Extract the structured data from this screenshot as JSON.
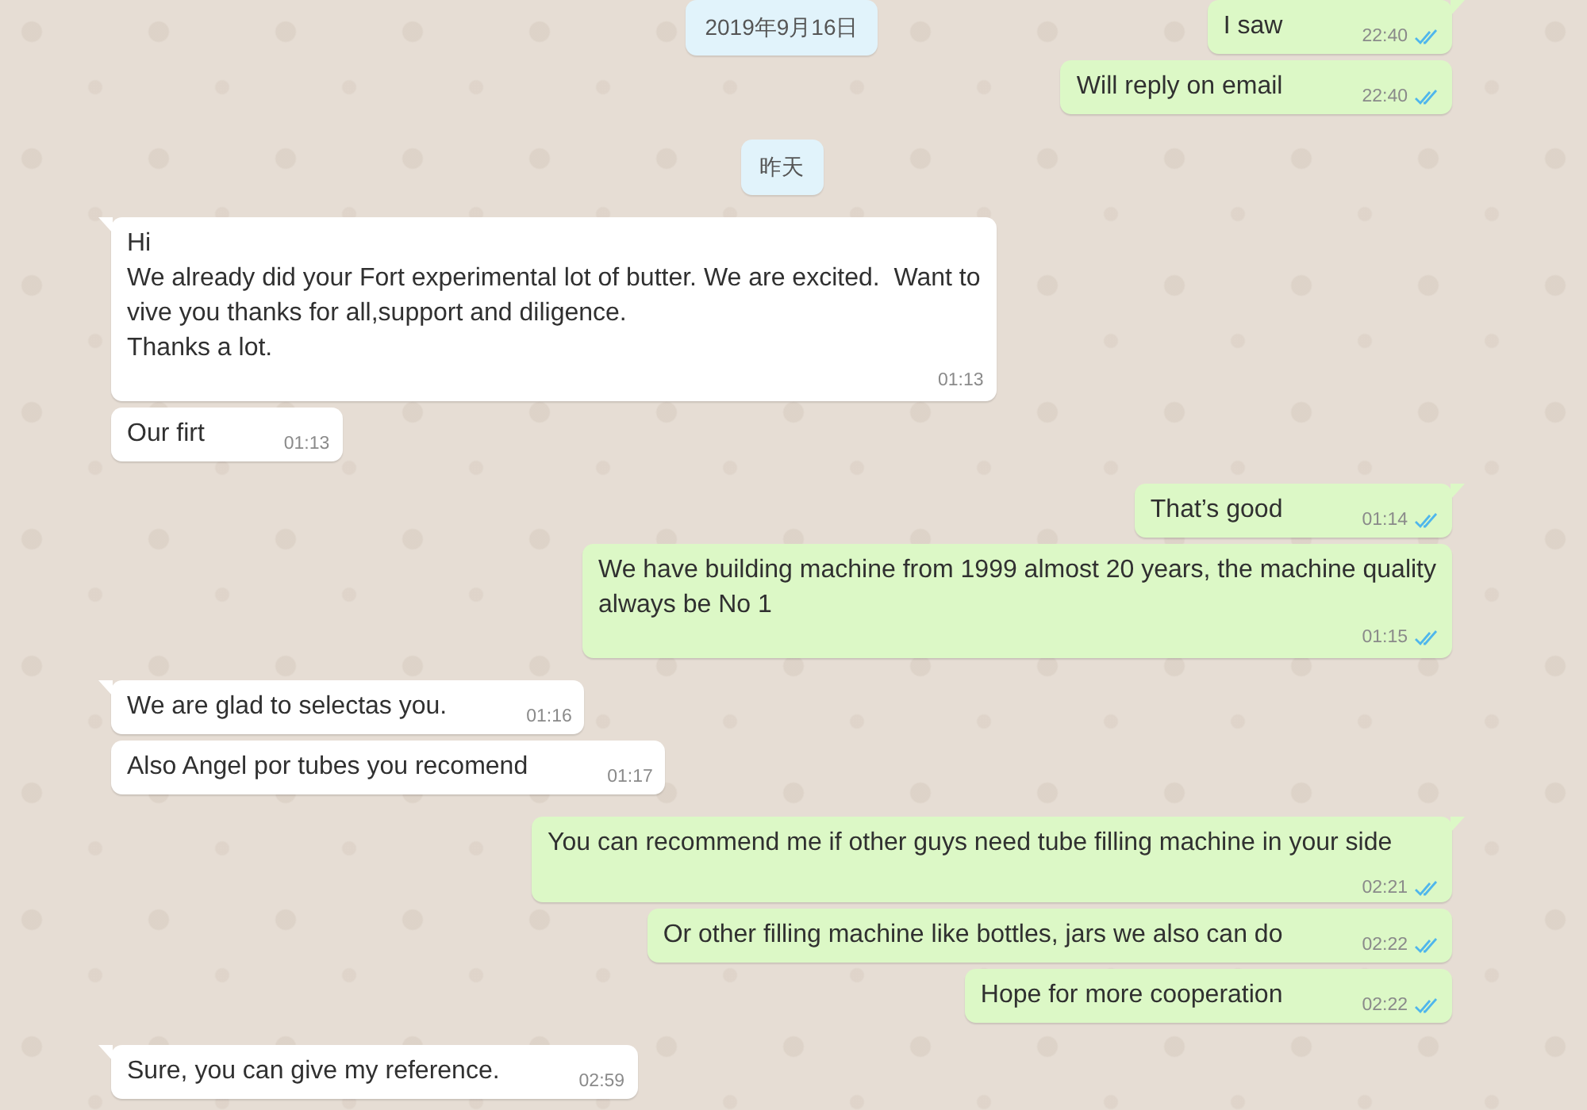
{
  "messages": [
    {
      "kind": "date",
      "text": "2019年9月16日"
    },
    {
      "kind": "out",
      "text": "I saw",
      "time": "22:40",
      "read": true
    },
    {
      "kind": "out",
      "text": "Will reply on email",
      "time": "22:40",
      "read": true
    },
    {
      "kind": "date",
      "text": "昨天"
    },
    {
      "kind": "in",
      "text": "Hi\nWe already did your Fort experimental lot of butter. We are excited.  Want to\nvive you thanks for all,support and diligence.\nThanks a lot.",
      "time": "01:13"
    },
    {
      "kind": "in",
      "text": "Our firt",
      "time": "01:13"
    },
    {
      "kind": "out",
      "text": "That’s good",
      "time": "01:14",
      "read": true
    },
    {
      "kind": "out",
      "text": "We have building machine from 1999 almost 20 years, the machine quality\nalways be No 1",
      "time": "01:15",
      "read": true
    },
    {
      "kind": "in",
      "text": "We are glad to selectas you.",
      "time": "01:16"
    },
    {
      "kind": "in",
      "text": "Also Angel por tubes you recomend",
      "time": "01:17"
    },
    {
      "kind": "out",
      "text": "You can recommend me if other guys need tube filling machine in your side",
      "time": "02:21",
      "read": true
    },
    {
      "kind": "out",
      "text": "Or other filling machine like bottles, jars we also can do",
      "time": "02:22",
      "read": true
    },
    {
      "kind": "out",
      "text": "Hope for more cooperation",
      "time": "02:22",
      "read": true
    },
    {
      "kind": "in",
      "text": "Sure, you can give my reference.",
      "time": "02:59"
    }
  ]
}
